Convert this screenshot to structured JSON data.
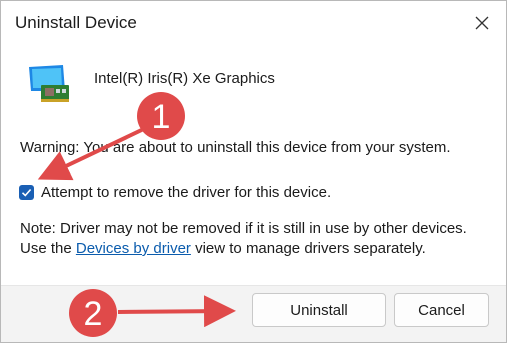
{
  "window": {
    "title": "Uninstall Device"
  },
  "device": {
    "name": "Intel(R) Iris(R) Xe Graphics",
    "icon": "display-adapter-icon"
  },
  "warning": {
    "text": "Warning: You are about to uninstall this device from your system."
  },
  "checkbox": {
    "label": "Attempt to remove the driver for this device.",
    "checked": true
  },
  "note": {
    "before_link": "Note: Driver may not be removed if it is still in use by other devices. Use the ",
    "link": "Devices by driver",
    "after_link": " view to manage drivers separately."
  },
  "buttons": {
    "uninstall": "Uninstall",
    "cancel": "Cancel"
  },
  "annotations": {
    "callout_1": "1",
    "callout_2": "2",
    "color": "#e04a4a"
  }
}
